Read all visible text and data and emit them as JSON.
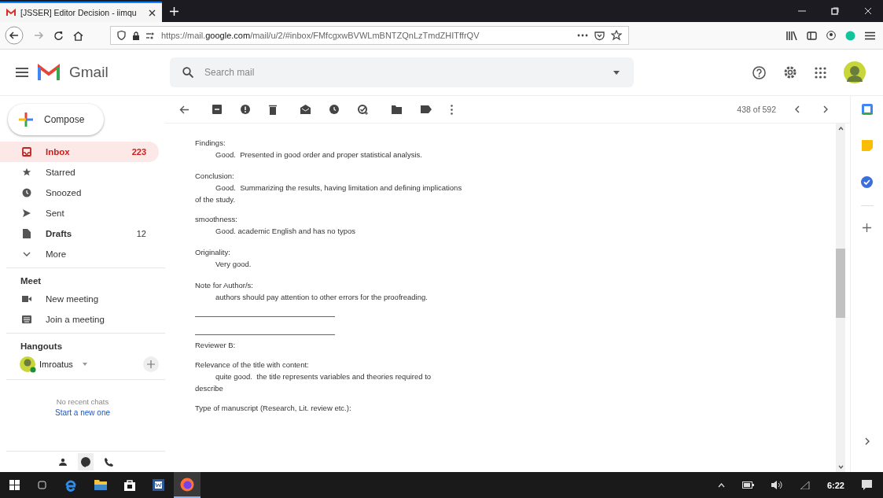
{
  "browser": {
    "tab_title": "[JSSER] Editor Decision - iimqu",
    "url_prefix": "https://mail.",
    "url_domain": "google.com",
    "url_path": "/mail/u/2/#inbox/FMfcgxwBVWLmBNTZQnLzTmdZHITffrQV"
  },
  "gmail": {
    "app_name": "Gmail",
    "search": {
      "placeholder": "Search mail"
    }
  },
  "sidebar": {
    "compose": "Compose",
    "items": [
      {
        "label": "Inbox",
        "count": "223",
        "selected": true,
        "bold": true
      },
      {
        "label": "Starred",
        "selected": false,
        "bold": false
      },
      {
        "label": "Snoozed",
        "selected": false,
        "bold": false
      },
      {
        "label": "Sent",
        "selected": false,
        "bold": false
      },
      {
        "label": "Drafts",
        "count": "12",
        "selected": false,
        "bold": true
      },
      {
        "label": "More",
        "selected": false,
        "bold": false
      }
    ],
    "meet": {
      "title": "Meet",
      "items": [
        "New meeting",
        "Join a meeting"
      ]
    },
    "hangouts": {
      "title": "Hangouts",
      "user": "Imroatus",
      "empty": "No recent chats",
      "link": "Start a new one"
    }
  },
  "toolbar": {
    "pager": "438 of 592"
  },
  "message": [
    {
      "kind": "heading",
      "text": "Findings:"
    },
    {
      "kind": "indent",
      "text": "Good.  Presented in good order and proper statistical analysis."
    },
    {
      "kind": "gap"
    },
    {
      "kind": "heading",
      "text": "Conclusion:"
    },
    {
      "kind": "indent",
      "text": "Good.  Summarizing the results, having limitation and defining implications"
    },
    {
      "kind": "heading",
      "text": "of the study."
    },
    {
      "kind": "gap"
    },
    {
      "kind": "heading",
      "text": "smoothness:"
    },
    {
      "kind": "indent",
      "text": "Good. academic English and has no typos"
    },
    {
      "kind": "gap"
    },
    {
      "kind": "heading",
      "text": "Originality:"
    },
    {
      "kind": "indent",
      "text": "Very good."
    },
    {
      "kind": "gap"
    },
    {
      "kind": "heading",
      "text": "Note for Author/s:"
    },
    {
      "kind": "indent",
      "text": "authors should pay attention to other errors for the proofreading."
    },
    {
      "kind": "gap"
    },
    {
      "kind": "rule"
    },
    {
      "kind": "gap"
    },
    {
      "kind": "rule"
    },
    {
      "kind": "heading",
      "text": "Reviewer B:"
    },
    {
      "kind": "gap"
    },
    {
      "kind": "heading",
      "text": "Relevance of the title with content:"
    },
    {
      "kind": "indent",
      "text": "quite good.  the title represents variables and theories required to"
    },
    {
      "kind": "heading",
      "text": "describe"
    },
    {
      "kind": "gap"
    },
    {
      "kind": "heading",
      "text": "Type of manuscript (Research, Lit. review etc.):"
    }
  ],
  "taskbar": {
    "time": "6:22"
  }
}
